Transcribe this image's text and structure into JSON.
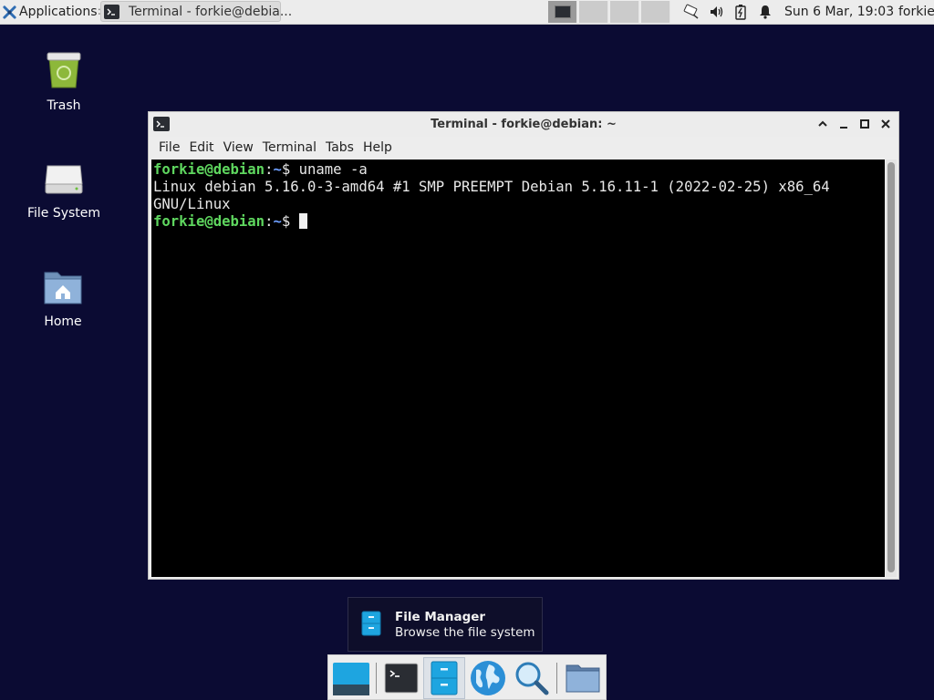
{
  "top_panel": {
    "applications_label": "Applications",
    "applications_suffix": "∷",
    "task_title": "Terminal - forkie@debia...",
    "clock": "Sun  6 Mar, 19:03",
    "user": "forkie"
  },
  "desktop": {
    "icons": [
      {
        "label": "Trash"
      },
      {
        "label": "File System"
      },
      {
        "label": "Home"
      }
    ]
  },
  "terminal": {
    "title": "Terminal - forkie@debian: ~",
    "menu": [
      "File",
      "Edit",
      "View",
      "Terminal",
      "Tabs",
      "Help"
    ],
    "prompt_user": "forkie@debian",
    "prompt_colon": ":",
    "prompt_path": "~",
    "prompt_dollar": "$ ",
    "command": "uname -a",
    "output_line1": "Linux debian 5.16.0-3-amd64 #1 SMP PREEMPT Debian 5.16.11-1 (2022-02-25) x86_64",
    "output_line2": "GNU/Linux"
  },
  "tooltip": {
    "title": "File Manager",
    "subtitle": "Browse the file system"
  },
  "colors": {
    "desktop_bg": "#0b0b33",
    "prompt_green": "#5fd75f",
    "prompt_blue": "#6e9fff",
    "accent_blue": "#1ea5e0"
  }
}
